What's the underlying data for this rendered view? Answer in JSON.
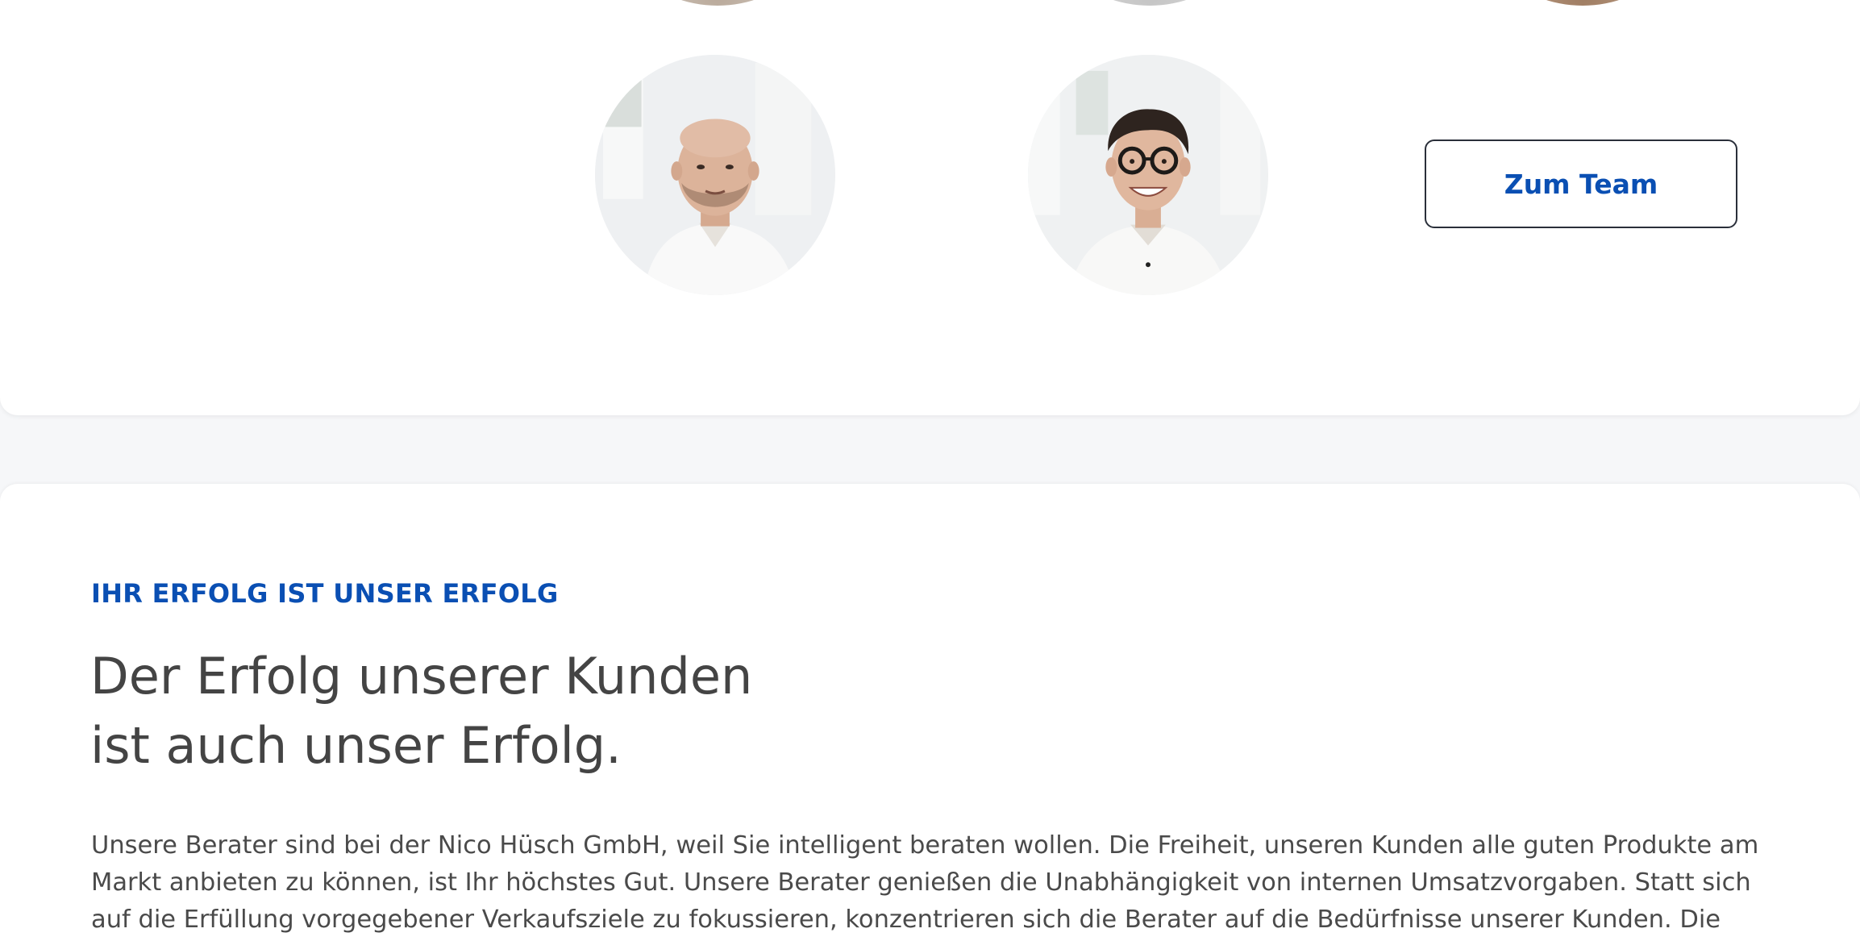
{
  "team_section": {
    "button_label": "Zum Team"
  },
  "success_section": {
    "eyebrow": "IHR ERFOLG IST UNSER ERFOLG",
    "headline_line1": "Der Erfolg unserer Kunden",
    "headline_line2": "ist auch unser Erfolg.",
    "body": "Unsere Berater sind bei der Nico Hüsch GmbH, weil Sie intelligent beraten wollen. Die Freiheit, unseren Kunden alle guten Produkte am Markt anbieten zu können, ist Ihr höchstes Gut. Unsere Berater genießen die Unabhängigkeit von internen Umsatzvorgaben. Statt sich auf die Erfüllung vorgegebener Verkaufsziele zu fokussieren, konzentrieren sich die Berater auf die Bedürfnisse unserer Kunden. Die Resultate"
  },
  "colors": {
    "accent": "#0a4fb3",
    "page_background": "#f6f7f9",
    "card_background": "#ffffff",
    "text": "#4a4a4a"
  }
}
